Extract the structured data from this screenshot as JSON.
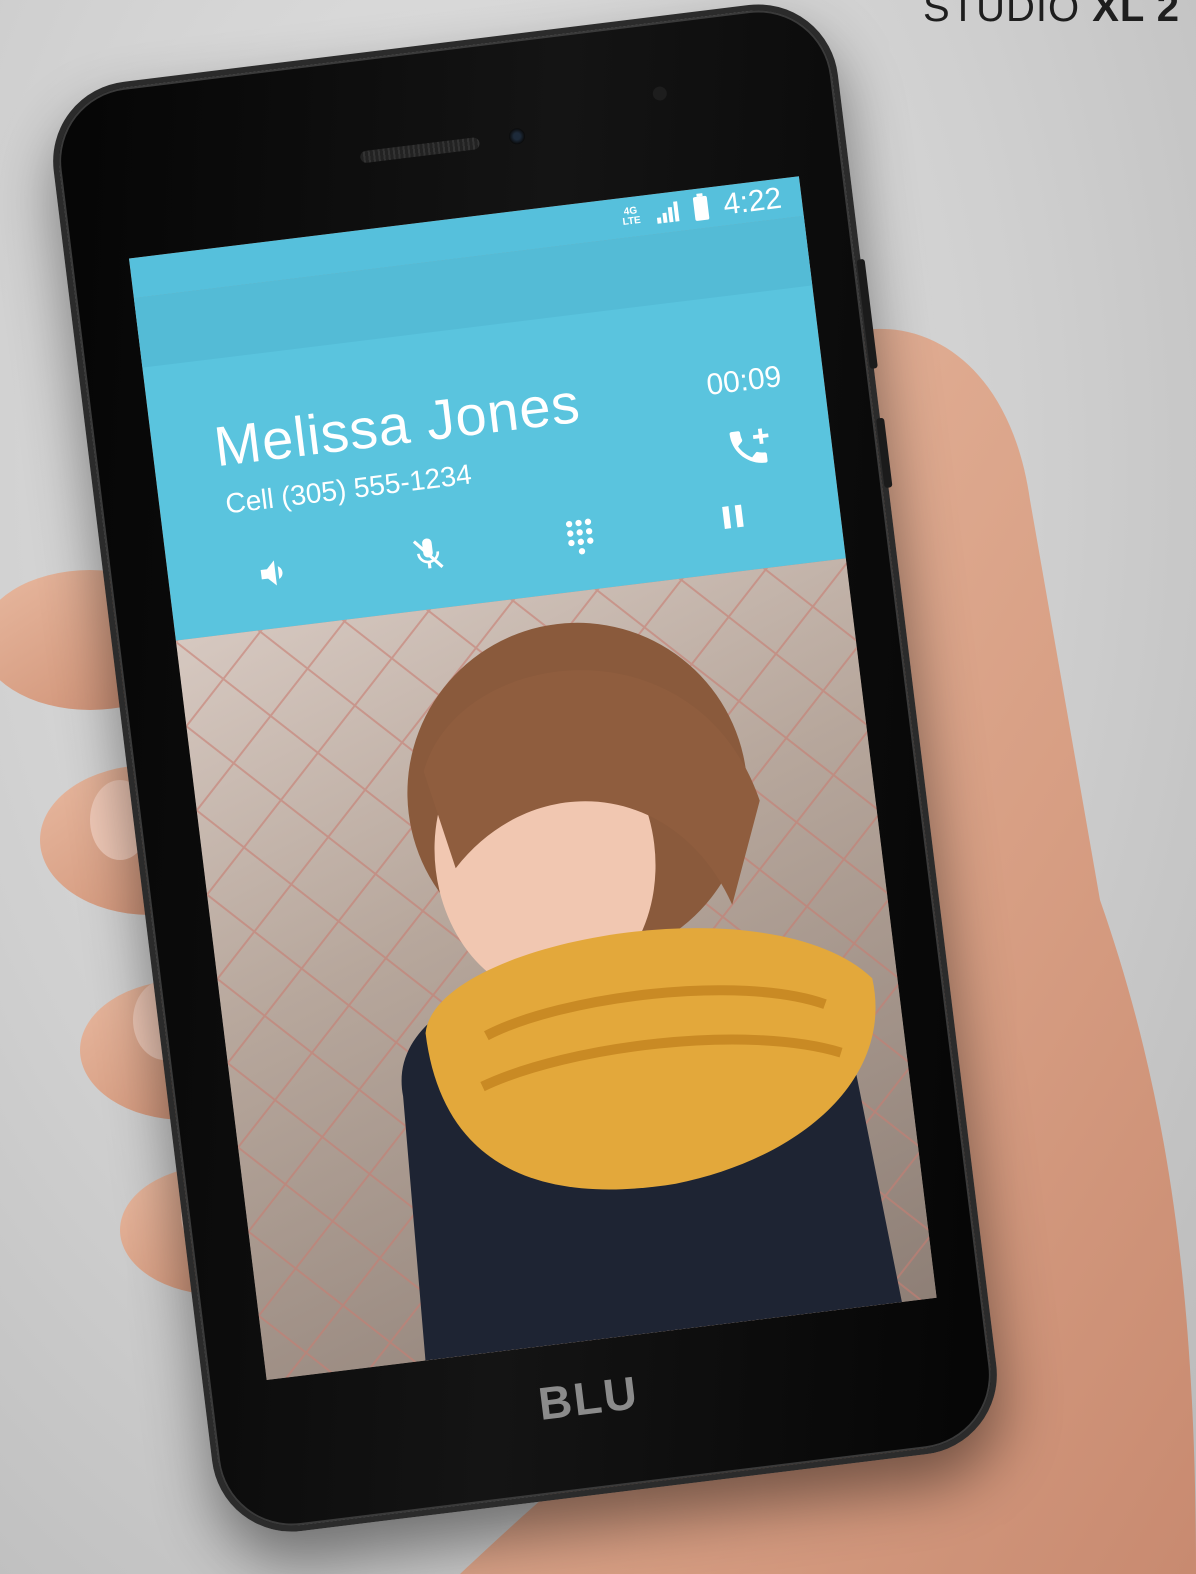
{
  "brand_corner": {
    "prefix": "STUDIO ",
    "bold": "XL 2"
  },
  "status_bar": {
    "network": "4G",
    "network_sub": "LTE",
    "time": "4:22",
    "icons": [
      "lte-icon",
      "signal-icon",
      "battery-icon"
    ]
  },
  "call": {
    "caller_name": "Melissa Jones",
    "caller_number": "Cell (305) 555-1234",
    "duration": "00:09",
    "accent_color": "#5ac4de",
    "controls": [
      {
        "name": "speaker-icon"
      },
      {
        "name": "mute-icon"
      },
      {
        "name": "dialpad-icon"
      },
      {
        "name": "hold-icon"
      },
      {
        "name": "add-call-icon"
      }
    ]
  },
  "phone_brand": "BLU"
}
